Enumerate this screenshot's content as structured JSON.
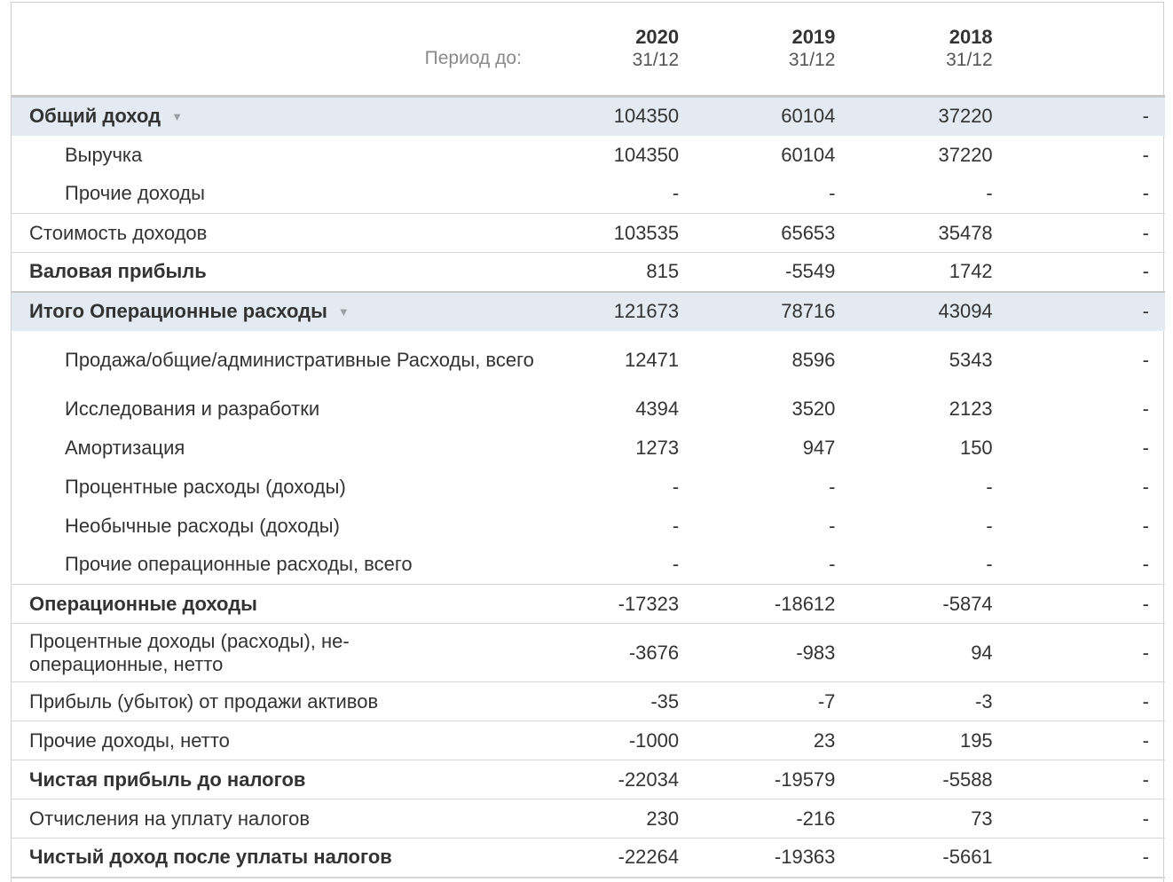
{
  "header": {
    "period_label": "Период до:",
    "columns": [
      {
        "year": "2020",
        "date": "31/12"
      },
      {
        "year": "2019",
        "date": "31/12"
      },
      {
        "year": "2018",
        "date": "31/12"
      }
    ]
  },
  "rows": [
    {
      "label": "Общий доход",
      "values": [
        "104350",
        "60104",
        "37220",
        "-"
      ]
    },
    {
      "label": "Выручка",
      "values": [
        "104350",
        "60104",
        "37220",
        "-"
      ]
    },
    {
      "label": "Прочие доходы",
      "values": [
        "-",
        "-",
        "-",
        "-"
      ]
    },
    {
      "label": "Стоимость доходов",
      "values": [
        "103535",
        "65653",
        "35478",
        "-"
      ]
    },
    {
      "label": "Валовая прибыль",
      "values": [
        "815",
        "-5549",
        "1742",
        "-"
      ]
    },
    {
      "label": "Итого Операционные расходы",
      "values": [
        "121673",
        "78716",
        "43094",
        "-"
      ]
    },
    {
      "label": "Продажа/общие/административные Расходы, всего",
      "values": [
        "12471",
        "8596",
        "5343",
        "-"
      ]
    },
    {
      "label": "Исследования и разработки",
      "values": [
        "4394",
        "3520",
        "2123",
        "-"
      ]
    },
    {
      "label": "Амортизация",
      "values": [
        "1273",
        "947",
        "150",
        "-"
      ]
    },
    {
      "label": "Процентные расходы (доходы)",
      "values": [
        "-",
        "-",
        "-",
        "-"
      ]
    },
    {
      "label": "Необычные расходы (доходы)",
      "values": [
        "-",
        "-",
        "-",
        "-"
      ]
    },
    {
      "label": "Прочие операционные расходы, всего",
      "values": [
        "-",
        "-",
        "-",
        "-"
      ]
    },
    {
      "label": "Операционные доходы",
      "values": [
        "-17323",
        "-18612",
        "-5874",
        "-"
      ]
    },
    {
      "label": "Процентные доходы (расходы), не-операционные, нетто",
      "values": [
        "-3676",
        "-983",
        "94",
        "-"
      ]
    },
    {
      "label": "Прибыль (убыток) от продажи активов",
      "values": [
        "-35",
        "-7",
        "-3",
        "-"
      ]
    },
    {
      "label": "Прочие доходы, нетто",
      "values": [
        "-1000",
        "23",
        "195",
        "-"
      ]
    },
    {
      "label": "Чистая прибыль до налогов",
      "values": [
        "-22034",
        "-19579",
        "-5588",
        "-"
      ]
    },
    {
      "label": "Отчисления на уплату налогов",
      "values": [
        "230",
        "-216",
        "73",
        "-"
      ]
    },
    {
      "label": "Чистый доход после уплаты налогов",
      "values": [
        "-22264",
        "-19363",
        "-5661",
        "-"
      ]
    }
  ]
}
